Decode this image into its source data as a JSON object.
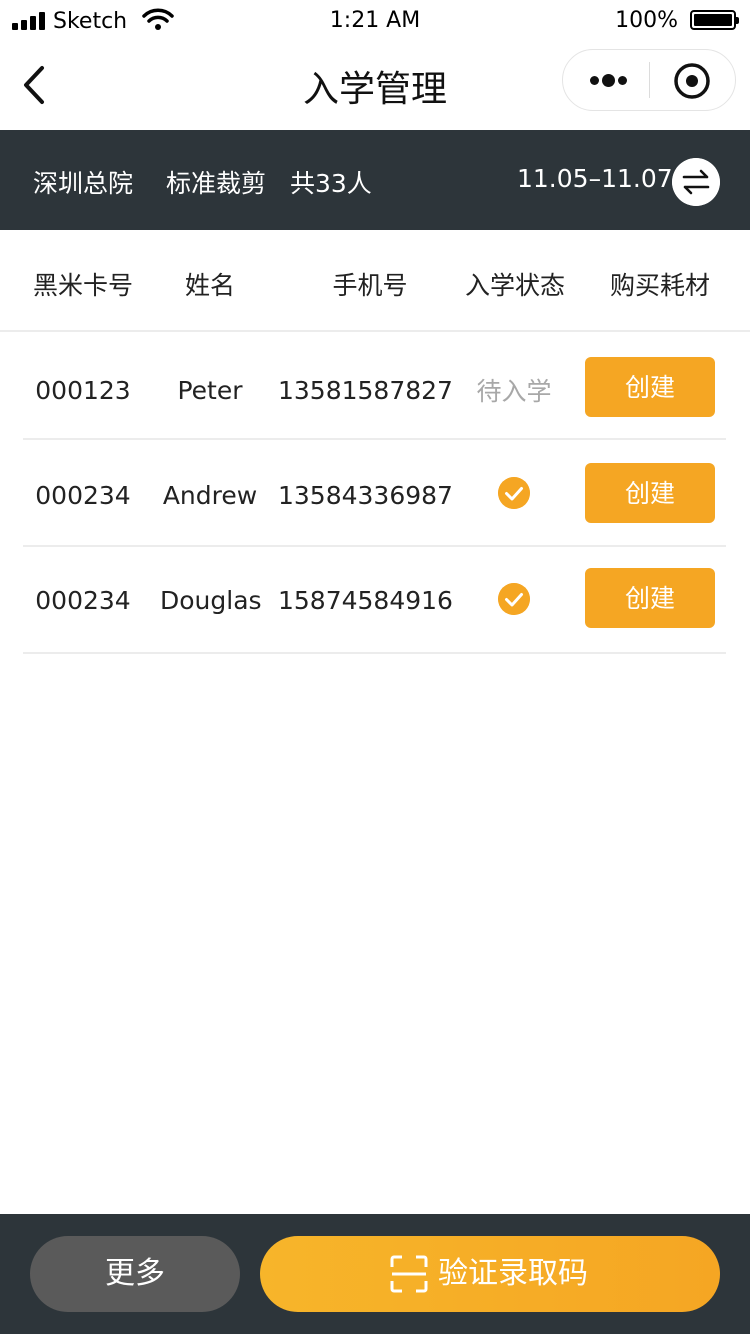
{
  "status_bar": {
    "carrier": "Sketch",
    "time": "1:21 AM",
    "battery": "100%"
  },
  "nav": {
    "title": "入学管理"
  },
  "info": {
    "campus": "深圳总院",
    "course": "标准裁剪",
    "total": "共33人",
    "date_range": "11.05–11.07"
  },
  "table": {
    "headers": {
      "card": "黑米卡号",
      "name": "姓名",
      "phone": "手机号",
      "status": "入学状态",
      "materials": "购买耗材"
    },
    "rows": [
      {
        "card": "000123",
        "name": "Peter",
        "phone": "13581587827",
        "status": "待入学",
        "action": "创建"
      },
      {
        "card": "000234",
        "name": "Andrew",
        "phone": "13584336987",
        "status": "",
        "action": "创建"
      },
      {
        "card": "000234",
        "name": "Douglas",
        "phone": "15874584916",
        "status": "",
        "action": "创建"
      }
    ]
  },
  "bottom": {
    "more_label": "更多",
    "verify_label": "验证录取码"
  },
  "colors": {
    "accent": "#f5a623",
    "dark_band": "#2d353a",
    "muted_button": "#5a5a5a"
  },
  "icons": [
    "signal-icon",
    "wifi-icon",
    "battery-icon",
    "back-arrow-icon",
    "more-dots-icon",
    "close-target-icon",
    "swap-arrows-icon",
    "check-circle-icon",
    "scan-frame-icon"
  ]
}
